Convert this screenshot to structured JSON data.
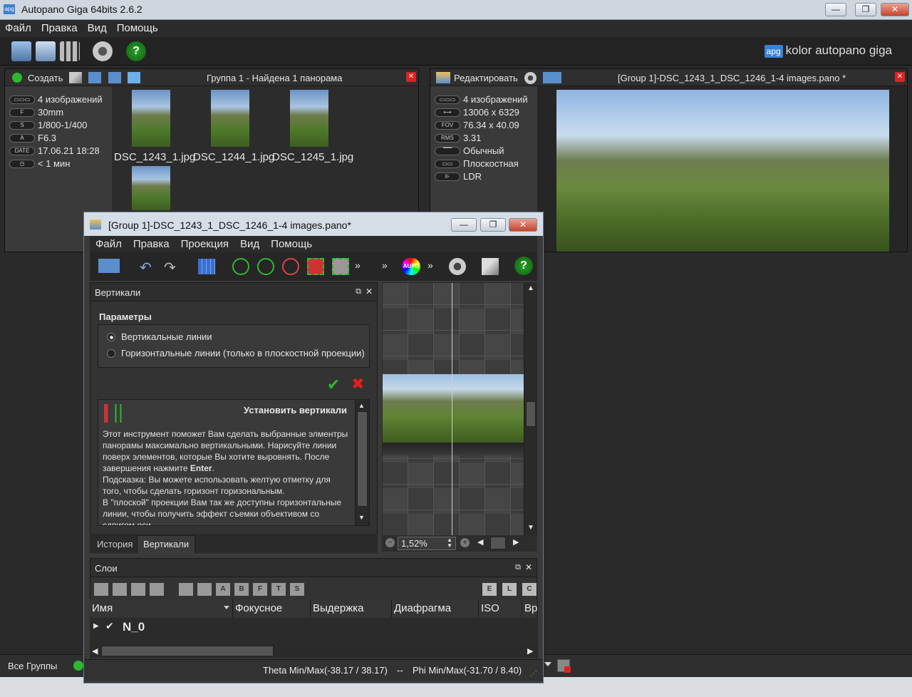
{
  "app": {
    "title": "Autopano Giga 64bits 2.6.2",
    "icon": "apg"
  },
  "window_buttons": {
    "minimize": "—",
    "restore": "❐",
    "close": "✕"
  },
  "menu": [
    "Файл",
    "Правка",
    "Вид",
    "Помощь"
  ],
  "toolbar": {
    "icons": [
      "select-images-icon",
      "detect-icon",
      "group-icon",
      "settings-icon",
      "help-icon"
    ]
  },
  "logo": {
    "badge": "apg",
    "text_light": "kolor",
    "text_bold": "autopano giga"
  },
  "left_panel": {
    "create_label": "Создать",
    "title": "Группа 1 - Найдена 1 панорама",
    "info": [
      {
        "icon": "▭▭▭",
        "value": "4 изображений"
      },
      {
        "icon": "F",
        "value": "30mm"
      },
      {
        "icon": "S",
        "value": "1/800-1/400"
      },
      {
        "icon": "A",
        "value": "F6.3"
      },
      {
        "icon": "DATE",
        "value": "17.06.21 18:28"
      },
      {
        "icon": "◷",
        "value": "< 1 мин"
      }
    ],
    "thumbnails": [
      "DSC_1243_1.jpg",
      "DSC_1244_1.jpg",
      "DSC_1245_1.jpg"
    ]
  },
  "right_panel": {
    "edit_label": "Редактировать",
    "title": "[Group 1]-DSC_1243_1_DSC_1246_1-4 images.pano *",
    "info": [
      {
        "icon": "▭▭▭",
        "value": "4 изображений"
      },
      {
        "icon": "⟷",
        "value": "13006 x 6329"
      },
      {
        "icon": "FOV",
        "value": "76.34 x 40.09"
      },
      {
        "icon": "RMS",
        "value": "3.31"
      },
      {
        "icon": "▔▔",
        "value": "Обычный"
      },
      {
        "icon": "▭▭",
        "value": "Плоскостная"
      },
      {
        "icon": "⊪",
        "value": "LDR"
      }
    ]
  },
  "bottom_bar": {
    "groups_label": "Все Группы"
  },
  "dialog": {
    "title": "[Group 1]-DSC_1243_1_DSC_1246_1-4 images.pano*",
    "menu": [
      "Файл",
      "Правка",
      "Проекция",
      "Вид",
      "Помощь"
    ],
    "verticals_panel": {
      "title": "Вертикали",
      "params_label": "Параметры",
      "option_vertical": "Вертикальные линии",
      "option_horizontal": "Горизонтальные линии (только в плоскостной проекции)",
      "help_title": "Установить вертикали",
      "help_p1": "Этот инструмент поможет Вам сделать выбранные элментры панорамы максимально вертикальными. Нарисуйте линии поверх элементов, которые Вы хотите выровнять. После завершения нажмите ",
      "help_enter": "Enter",
      "help_p1_end": ".",
      "help_p2": "Подсказка: Вы можете использовать желтую отметку для того, чтобы сделать горизонт горизональным.",
      "help_p3": "В \"плоской\" проекции Вам так же доступны горизонтальные линии, чтобы получить эффект съемки объективом со сдвигом оси."
    },
    "tabs": [
      "История",
      "Вертикали"
    ],
    "zoom": "1,52%",
    "layers": {
      "title": "Слои",
      "columns": [
        "Имя",
        "Фокусное",
        "Выдержка",
        "Диафрагма",
        "ISO",
        "Вр"
      ],
      "row_name": "N_0",
      "letter_buttons": [
        "A",
        "B",
        "F",
        "T",
        "S"
      ],
      "right_buttons": [
        "E",
        "L",
        "C"
      ]
    },
    "status": {
      "theta": "Theta Min/Max(-38.17 / 38.17)",
      "sep": "--",
      "phi": "Phi Min/Max(-31.70 / 8.40)"
    }
  },
  "colors": {
    "accent_green": "#2eb82e",
    "accent_red": "#e02020",
    "accent_blue": "#3b82d4"
  }
}
